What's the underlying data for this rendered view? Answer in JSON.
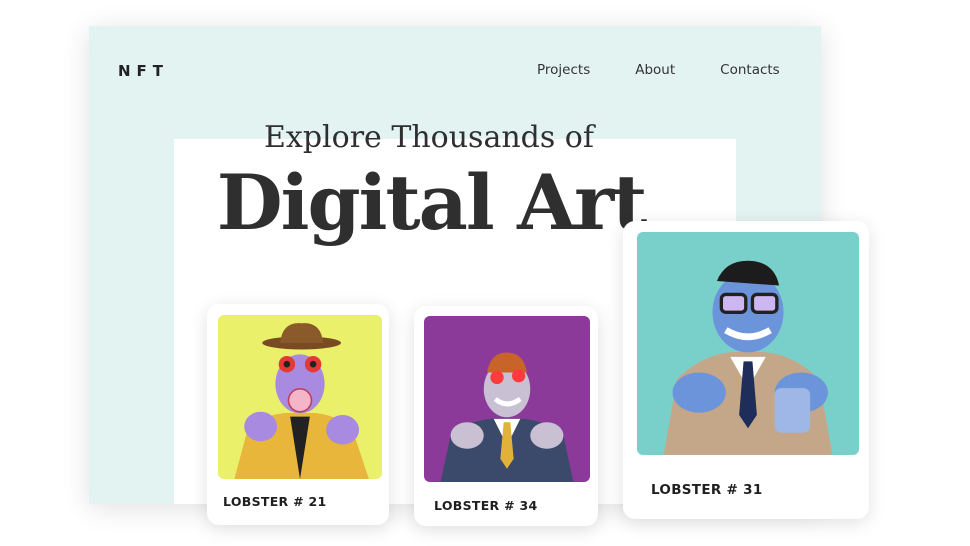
{
  "brand": {
    "logo": "NFT"
  },
  "nav": {
    "items": [
      "Projects",
      "About",
      "Contacts"
    ]
  },
  "hero": {
    "subtitle": "Explore Thousands of",
    "title": "Digital Art"
  },
  "cards": [
    {
      "label": "LOBSTER # 21",
      "bg": "#eaf06a",
      "body": "#a88ae0",
      "jacket": "#e7b63a"
    },
    {
      "label": "LOBSTER # 34",
      "bg": "#8c3a9a",
      "body": "#c9c0d4",
      "jacket": "#3b4a6b"
    },
    {
      "label": "LOBSTER # 31",
      "bg": "#79d0cb",
      "body": "#6b94db",
      "jacket": "#c4a789"
    }
  ],
  "colors": {
    "window_bg": "#e3f3f2",
    "text": "#2f2f2f"
  }
}
